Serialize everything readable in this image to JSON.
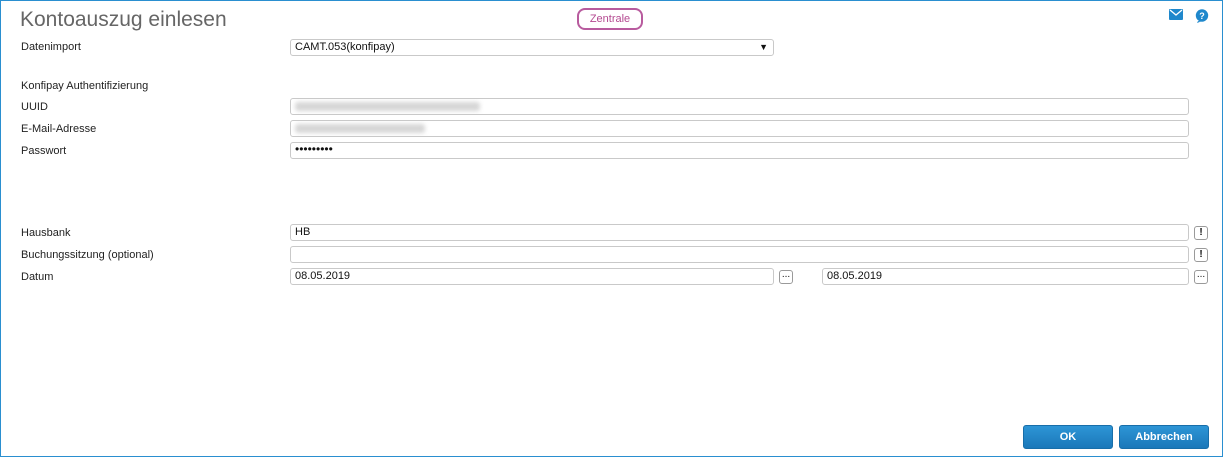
{
  "header": {
    "title": "Kontoauszug einlesen",
    "badge": "Zentrale"
  },
  "icons": {
    "mail": "envelope-icon",
    "help": "help-icon"
  },
  "form": {
    "datenimport": {
      "label": "Datenimport",
      "value": "CAMT.053(konfipay)",
      "arrow": "▼"
    },
    "auth_section": "Konfipay Authentifizierung",
    "uuid": {
      "label": "UUID",
      "value": ""
    },
    "email": {
      "label": "E-Mail-Adresse",
      "value": ""
    },
    "passwort": {
      "label": "Passwort",
      "value": "•••••••••"
    },
    "hausbank": {
      "label": "Hausbank",
      "value": "HB",
      "button": "!"
    },
    "buchungssitzung": {
      "label": "Buchungssitzung (optional)",
      "value": "",
      "button": "!"
    },
    "datum": {
      "label": "Datum",
      "from": "08.05.2019",
      "to": "08.05.2019",
      "picker": "..."
    }
  },
  "footer": {
    "ok": "OK",
    "cancel": "Abbrechen"
  },
  "colors": {
    "accent": "#2a8fd0",
    "badge_border": "#b85b9e",
    "button": "#1f82c4"
  }
}
